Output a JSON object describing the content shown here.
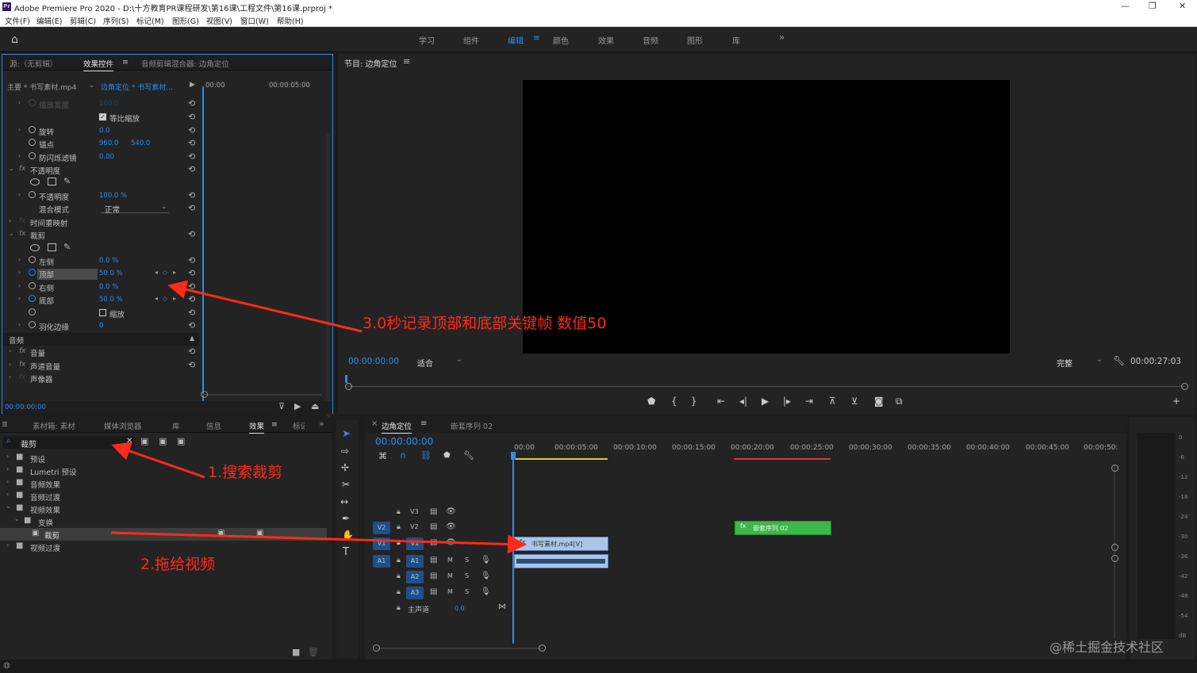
{
  "window": {
    "title": "Adobe Premiere Pro 2020 - D:\\十方教育PR课程研发\\第16课\\工程文件\\第16课.prproj *",
    "app_icon": "Pr"
  },
  "menu": [
    "文件(F)",
    "编辑(E)",
    "剪辑(C)",
    "序列(S)",
    "标记(M)",
    "图形(G)",
    "视图(V)",
    "窗口(W)",
    "帮助(H)"
  ],
  "workspaces": [
    "学习",
    "组件",
    "编辑",
    "颜色",
    "效果",
    "音频",
    "图形",
    "库"
  ],
  "active_workspace": "编辑",
  "source_panel": {
    "tabs": [
      "源:（无剪辑）",
      "效果控件",
      "音频剪辑混合器: 边角定位"
    ],
    "master": "主要 * 书写素材.mp4",
    "clip": "边角定位 * 书写素材...",
    "time_start": "00:00",
    "time_end": "00:00:05:00",
    "rows": [
      {
        "label": "缩放宽度",
        "v1": "100.0",
        "v2": ""
      },
      {
        "label": "等比缩放",
        "v1": "",
        "v2": ""
      },
      {
        "label": "旋转",
        "v1": "0.0",
        "v2": ""
      },
      {
        "label": "锚点",
        "v1": "960.0",
        "v2": "540.0"
      },
      {
        "label": "防闪烁滤镜",
        "v1": "0.00",
        "v2": ""
      },
      {
        "label": "不透明度",
        "v1": "",
        "v2": ""
      },
      {
        "label": "不透明度",
        "v1": "100.0 %",
        "v2": ""
      },
      {
        "label": "混合模式",
        "v1": "正常",
        "v2": ""
      },
      {
        "label": "时间重映射",
        "v1": "",
        "v2": ""
      },
      {
        "label": "裁剪",
        "v1": "",
        "v2": ""
      },
      {
        "label": "左侧",
        "v1": "0.0 %",
        "v2": ""
      },
      {
        "label": "顶部",
        "v1": "50.0 %",
        "v2": ""
      },
      {
        "label": "右侧",
        "v1": "0.0 %",
        "v2": ""
      },
      {
        "label": "底部",
        "v1": "50.0 %",
        "v2": ""
      },
      {
        "label": "缩放",
        "v1": "",
        "v2": ""
      },
      {
        "label": "羽化边缘",
        "v1": "0",
        "v2": ""
      },
      {
        "label": "音频",
        "v1": "",
        "v2": ""
      },
      {
        "label": "音量",
        "v1": "",
        "v2": ""
      },
      {
        "label": "声道音量",
        "v1": "",
        "v2": ""
      },
      {
        "label": "声像器",
        "v1": "",
        "v2": ""
      }
    ],
    "timecode": "00:00:00:00"
  },
  "program": {
    "title": "节目: 边角定位",
    "timecode": "00:00:00:00",
    "fit": "适合",
    "quality": "完整",
    "duration": "00:00:27:03"
  },
  "effects_panel": {
    "tabs": [
      "素材箱: 素材",
      "媒体浏览器",
      "库",
      "信息",
      "效果",
      "标记"
    ],
    "search": "裁剪",
    "tree": [
      "预设",
      "Lumetri 预设",
      "音频效果",
      "音频过渡",
      "视频效果",
      "变换",
      "裁剪",
      "视频过渡"
    ]
  },
  "timeline": {
    "tabs": [
      "边角定位",
      "嵌套序列 02"
    ],
    "timecode": "00:00:00:00",
    "ruler": [
      "00:00",
      "00:00:05:00",
      "00:00:10:00",
      "00:00:15:00",
      "00:00:20:00",
      "00:00:25:00",
      "00:00:30:00",
      "00:00:35:00",
      "00:00:40:00",
      "00:00:45:00",
      "00:00:50:"
    ],
    "tracks": [
      "V3",
      "V2",
      "V1",
      "A1",
      "A2",
      "A3"
    ],
    "master": "主声道",
    "master_val": "0.0",
    "clips": {
      "v1": "书写素材.mp4[V]",
      "v2": "嵌套序列 02"
    }
  },
  "meter_ticks": [
    "0",
    "-6",
    "-12",
    "-18",
    "-24",
    "-30",
    "-36",
    "-42",
    "-48",
    "-54",
    "dB"
  ],
  "annotations": {
    "a1": "1.搜索裁剪",
    "a2": "2.拖给视频",
    "a3": "3.0秒记录顶部和底部关键帧 数值50"
  },
  "watermark": "@稀土掘金技术社区",
  "colors": {
    "accent": "#2d8ceb",
    "annotation": "#ff2a1a",
    "clip_v1": "#a9c5ea",
    "clip_v2": "#3db64a"
  }
}
